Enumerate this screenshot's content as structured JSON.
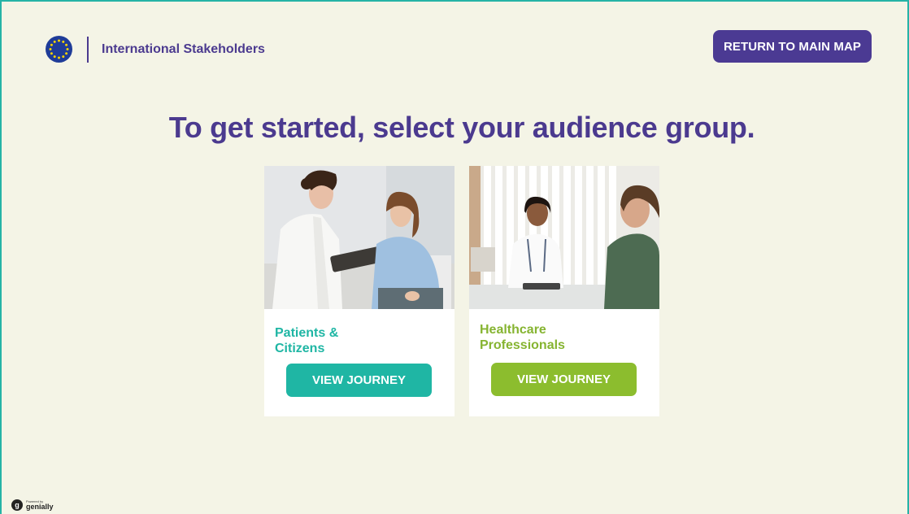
{
  "header": {
    "logo_icon": "eu-flag-icon",
    "title": "International Stakeholders"
  },
  "return_button": {
    "label": "RETURN TO MAIN MAP"
  },
  "headline": "To get started, select your audience group.",
  "cards": [
    {
      "title_line1": "Patients &",
      "title_line2": "Citizens",
      "button_label": "VIEW JOURNEY",
      "accent": "#1fb6a4",
      "photo": "doctor-with-tablet-and-patient-photo"
    },
    {
      "title_line1": "Healthcare",
      "title_line2": "Professionals",
      "button_label": "VIEW JOURNEY",
      "accent": "#8cbd2e",
      "photo": "doctor-at-desk-with-patient-photo"
    }
  ],
  "footer": {
    "powered_by": "Powered by",
    "brand": "genially"
  },
  "colors": {
    "background": "#f4f4e6",
    "primary": "#4b3a8f",
    "teal": "#1fb6a4",
    "green": "#8cbd2e"
  }
}
